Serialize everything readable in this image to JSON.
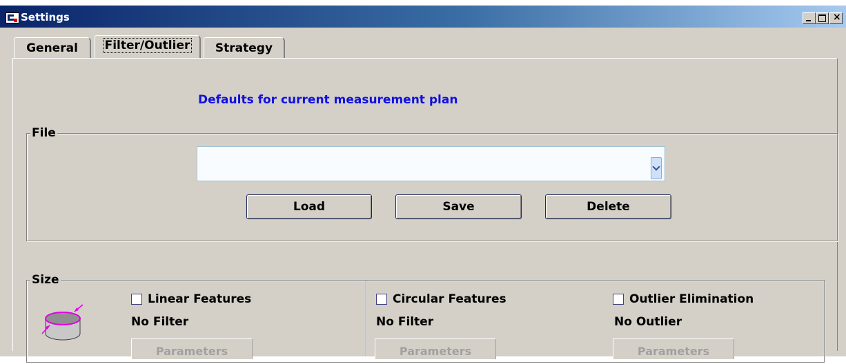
{
  "window": {
    "title": "Settings",
    "buttons": [
      "minimize",
      "maximize",
      "close"
    ]
  },
  "tabs": [
    {
      "label": "General",
      "active": false
    },
    {
      "label": "Filter/Outlier",
      "active": true
    },
    {
      "label": "Strategy",
      "active": false
    }
  ],
  "heading": "Defaults for current measurement plan",
  "file": {
    "legend": "File",
    "combo_value": "",
    "buttons": {
      "load": "Load",
      "save": "Save",
      "delete": "Delete"
    }
  },
  "size": {
    "legend": "Size",
    "icon": "cylinder-diameter-icon",
    "columns": [
      {
        "checkbox_label": "Linear Features",
        "checked": false,
        "status": "No Filter",
        "button": "Parameters"
      },
      {
        "checkbox_label": "Circular Features",
        "checked": false,
        "status": "No Filter",
        "button": "Parameters"
      },
      {
        "checkbox_label": "Outlier Elimination",
        "checked": false,
        "status": "No Outlier",
        "button": "Parameters"
      }
    ]
  },
  "colors": {
    "heading": "#1010e0",
    "titlebar_start": "#0a246a",
    "titlebar_end": "#a6caf0",
    "dialog_bg": "#d4d0c8"
  }
}
